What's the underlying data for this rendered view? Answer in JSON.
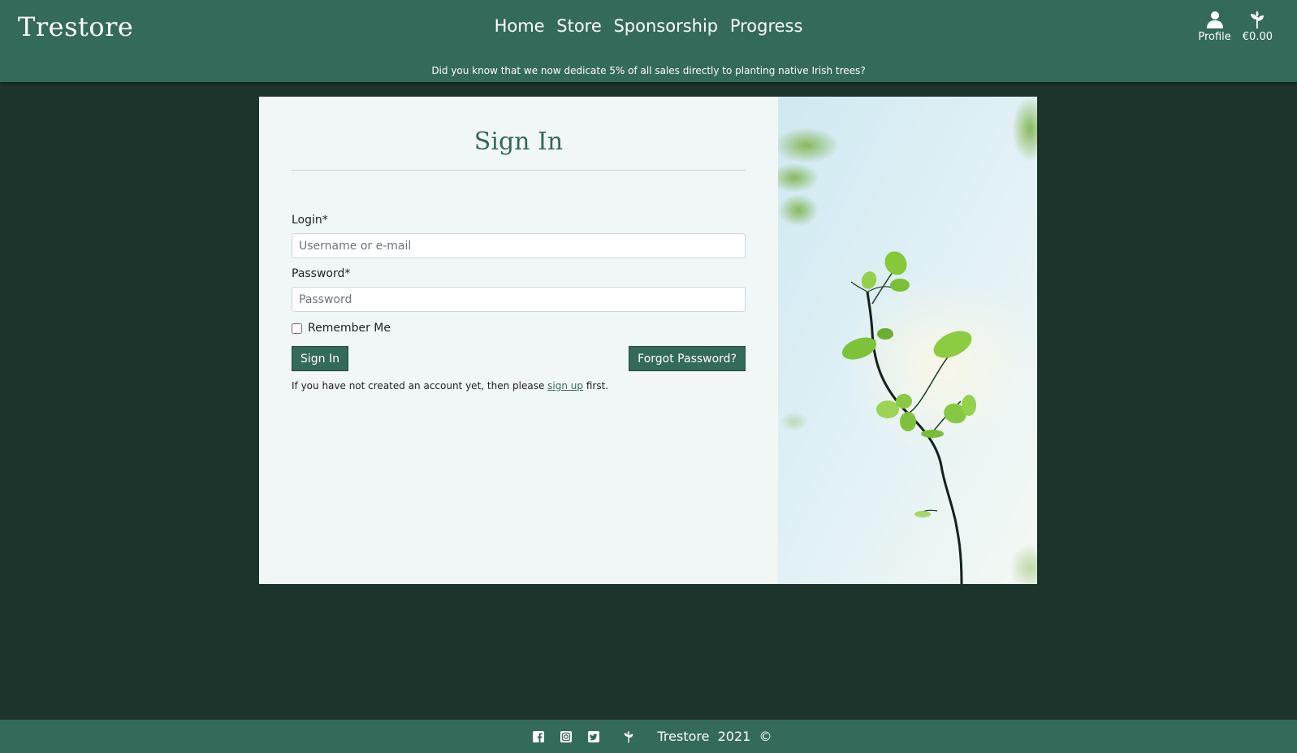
{
  "header": {
    "brand": "Trestore",
    "nav": [
      "Home",
      "Store",
      "Sponsorship",
      "Progress"
    ],
    "profile_label": "Profile",
    "cart_total": "€0.00",
    "banner": "Did you know that we now dedicate 5% of all sales directly to planting native Irish trees?"
  },
  "signin": {
    "title": "Sign In",
    "login_label": "Login*",
    "login_placeholder": "Username or e-mail",
    "password_label": "Password*",
    "password_placeholder": "Password",
    "remember_label": "Remember Me",
    "submit_label": "Sign In",
    "forgot_label": "Forgot Password?",
    "note_before": "If you have not created an account yet, then please ",
    "note_link": "sign up",
    "note_after": " first."
  },
  "footer": {
    "text": "Trestore  2021  ©",
    "icons": [
      "facebook-icon",
      "instagram-icon",
      "twitter-icon",
      "leaf-icon"
    ]
  },
  "colors": {
    "primary": "#346a59",
    "background": "#1c342c",
    "card": "#f1f7f6"
  }
}
